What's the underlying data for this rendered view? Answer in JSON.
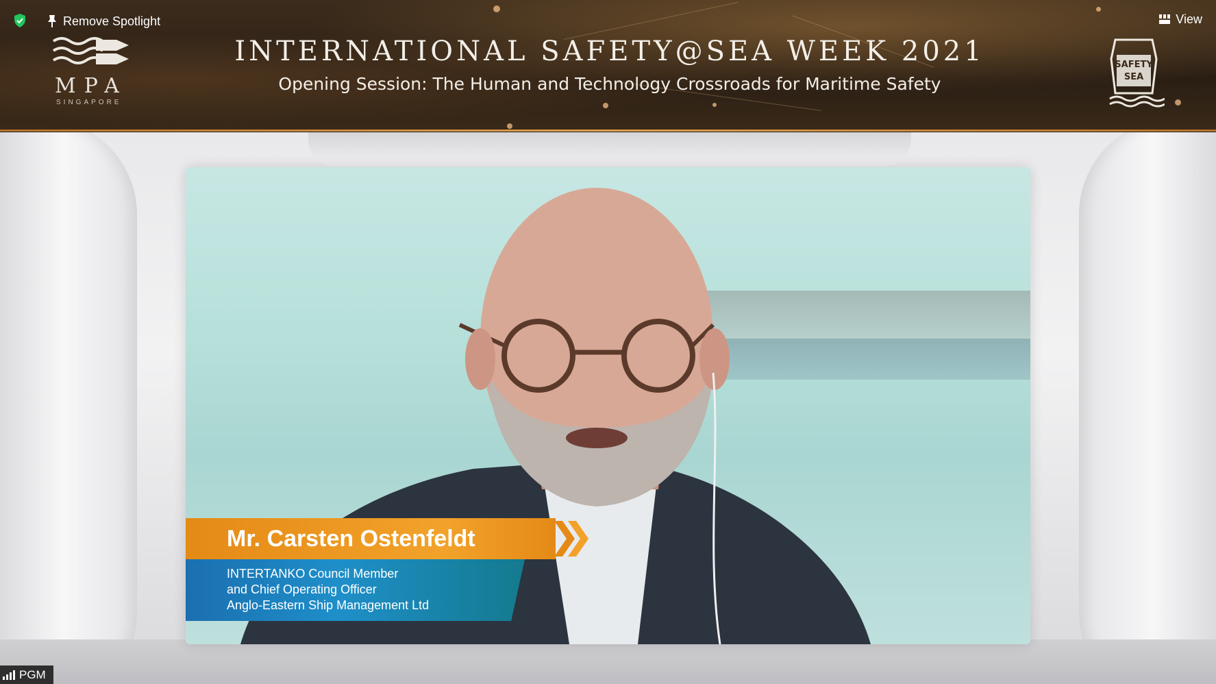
{
  "banner": {
    "org_name": "MPA",
    "org_sub": "SINGAPORE",
    "title": "INTERNATIONAL SAFETY@SEA WEEK 2021",
    "subtitle": "Opening Session: The Human and Technology Crossroads for Maritime Safety",
    "badge_line1": "SAFETY",
    "badge_line2": "SEA"
  },
  "toolbar": {
    "remove_spotlight_label": "Remove Spotlight",
    "view_label": "View"
  },
  "speaker": {
    "name": "Mr. Carsten Ostenfeldt",
    "title_lines": [
      "INTERTANKO Council Member",
      "and Chief Operating Officer",
      "Anglo-Eastern Ship Management Ltd"
    ]
  },
  "participant": {
    "label": "PGM"
  },
  "colors": {
    "accent_orange": "#f2a22a",
    "lower_third_blue": "#1e8fc9",
    "security_green": "#22c55e"
  }
}
